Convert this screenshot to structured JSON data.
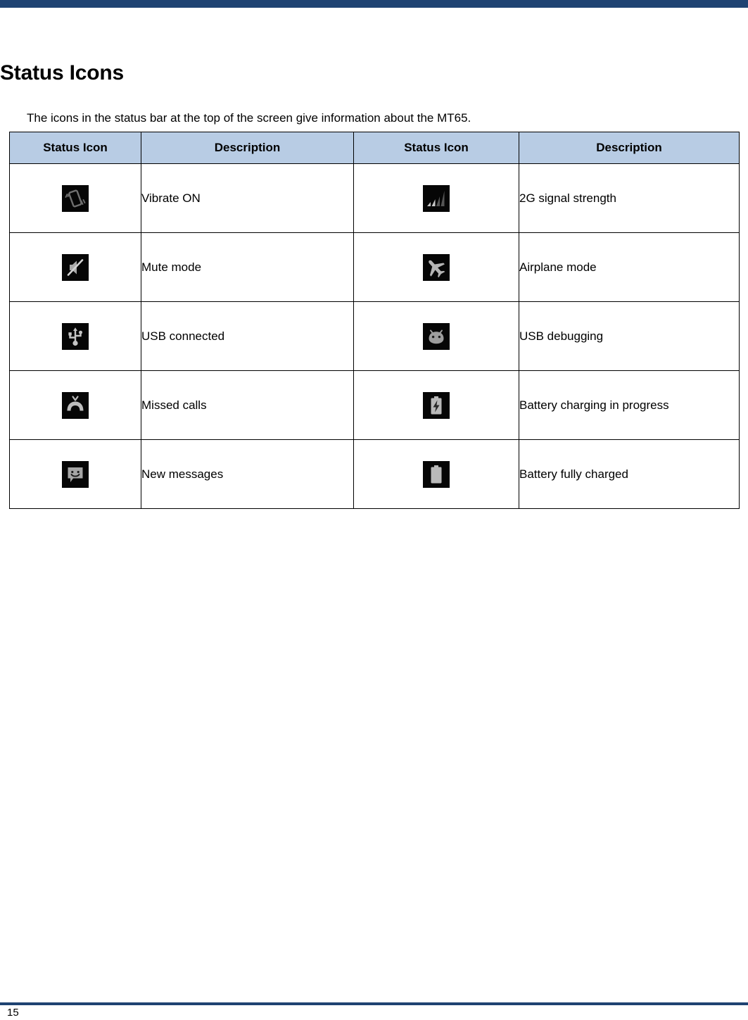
{
  "document": {
    "page_title": "Status Icons",
    "intro": "The icons in the status bar at the top of the screen give information about the MT65.",
    "page_number": "15",
    "accent_color": "#1f4372",
    "table_header_color": "#b8cce4"
  },
  "table": {
    "headers": [
      "Status Icon",
      "Description",
      "Status Icon",
      "Description"
    ],
    "rows": [
      {
        "left_icon": "vibrate-on-icon",
        "left_desc": "Vibrate ON",
        "right_icon": "signal-strength-2g-icon",
        "right_desc": "2G signal strength"
      },
      {
        "left_icon": "mute-mode-icon",
        "left_desc": "Mute mode",
        "right_icon": "airplane-mode-icon",
        "right_desc": "Airplane mode"
      },
      {
        "left_icon": "usb-connected-icon",
        "left_desc": "USB connected",
        "right_icon": "usb-debugging-icon",
        "right_desc": "USB debugging"
      },
      {
        "left_icon": "missed-calls-icon",
        "left_desc": "Missed calls",
        "right_icon": "battery-charging-icon",
        "right_desc": "Battery charging in progress"
      },
      {
        "left_icon": "new-messages-icon",
        "left_desc": "New messages",
        "right_icon": "battery-full-icon",
        "right_desc": "Battery fully charged"
      }
    ]
  }
}
